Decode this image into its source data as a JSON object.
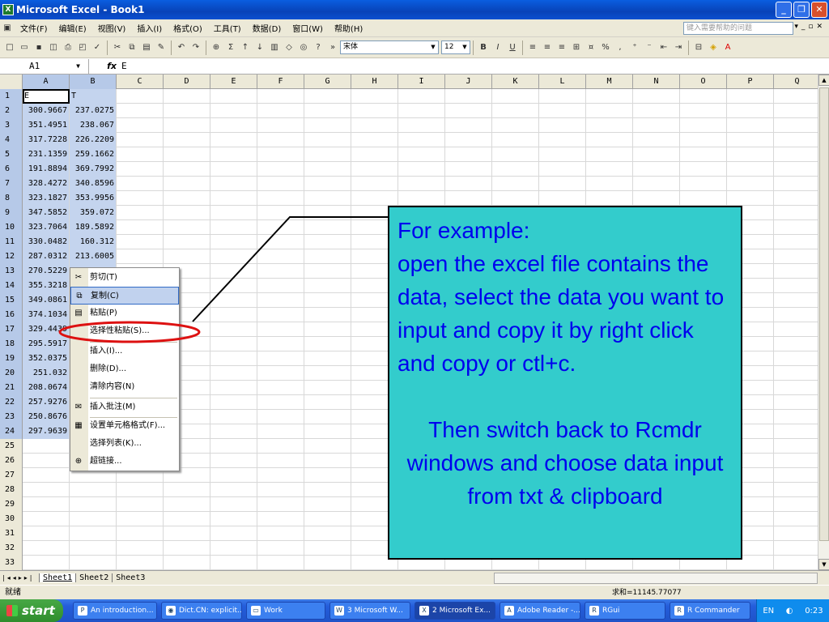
{
  "window": {
    "title": "Microsoft Excel - Book1",
    "app_icon": "excel-icon"
  },
  "menu": {
    "items": [
      "文件(F)",
      "编辑(E)",
      "视图(V)",
      "插入(I)",
      "格式(O)",
      "工具(T)",
      "数据(D)",
      "窗口(W)",
      "帮助(H)"
    ],
    "help_placeholder": "键入需要帮助的问题"
  },
  "toolbar": {
    "font_name": "宋体",
    "font_size": "12"
  },
  "formula_bar": {
    "name_box": "A1",
    "fx": "fx",
    "value": "E"
  },
  "sheet": {
    "columns": [
      "A",
      "B",
      "C",
      "D",
      "E",
      "F",
      "G",
      "H",
      "I",
      "J",
      "K",
      "L",
      "M",
      "N",
      "O",
      "P",
      "Q"
    ],
    "row_numbers": [
      "1",
      "2",
      "3",
      "4",
      "5",
      "6",
      "7",
      "8",
      "9",
      "10",
      "11",
      "12",
      "13",
      "14",
      "15",
      "16",
      "17",
      "18",
      "19",
      "20",
      "21",
      "22",
      "23",
      "24",
      "25",
      "26",
      "27",
      "28",
      "29",
      "30",
      "31",
      "32",
      "33"
    ],
    "data": [
      [
        "E",
        "T"
      ],
      [
        "300.9667",
        "237.0275"
      ],
      [
        "351.4951",
        "238.067"
      ],
      [
        "317.7228",
        "226.2209"
      ],
      [
        "231.1359",
        "259.1662"
      ],
      [
        "191.8894",
        "369.7992"
      ],
      [
        "328.4272",
        "340.8596"
      ],
      [
        "323.1827",
        "353.9956"
      ],
      [
        "347.5852",
        "359.072"
      ],
      [
        "323.7064",
        "189.5892"
      ],
      [
        "330.0482",
        "160.312"
      ],
      [
        "287.0312",
        "213.6005"
      ],
      [
        "270.5229",
        ""
      ],
      [
        "355.3218",
        ""
      ],
      [
        "349.0861",
        ""
      ],
      [
        "374.1034",
        ""
      ],
      [
        "329.4439",
        ""
      ],
      [
        "295.5917",
        ""
      ],
      [
        "352.0375",
        ""
      ],
      [
        "251.032",
        ""
      ],
      [
        "208.0674",
        ""
      ],
      [
        "257.9276",
        ""
      ],
      [
        "250.8676",
        ""
      ],
      [
        "297.9639",
        ""
      ]
    ]
  },
  "context_menu": {
    "items": [
      "剪切(T)",
      "复制(C)",
      "粘贴(P)",
      "选择性粘贴(S)...",
      "插入(I)...",
      "删除(D)...",
      "清除内容(N)",
      "插入批注(M)",
      "设置单元格格式(F)...",
      "选择列表(K)...",
      "超链接..."
    ],
    "highlighted": "复制(C)",
    "circled": "选择性粘贴(S)..."
  },
  "sheet_tabs": [
    "Sheet1",
    "Sheet2",
    "Sheet3"
  ],
  "status": {
    "ready": "就绪",
    "sum": "求和=11145.77077"
  },
  "taskbar": {
    "start": "start",
    "tasks": [
      "An introduction...",
      "Dict.CN: explicit...",
      "Work",
      "3 Microsoft W...",
      "2 Microsoft Ex...",
      "Adobe Reader -...",
      "RGui",
      "R Commander"
    ],
    "lang": "EN",
    "clock": "0:23"
  },
  "callout": {
    "heading": "For example:",
    "body": "open the excel file contains the data, select the data you want to input and copy it by right click and copy or ctl+c.",
    "footer": "Then switch back to Rcmdr windows and choose data input from txt & clipboard",
    "bg": "#33cccc",
    "text_color": "#0000ee",
    "annotation_color": "#dd1111"
  }
}
